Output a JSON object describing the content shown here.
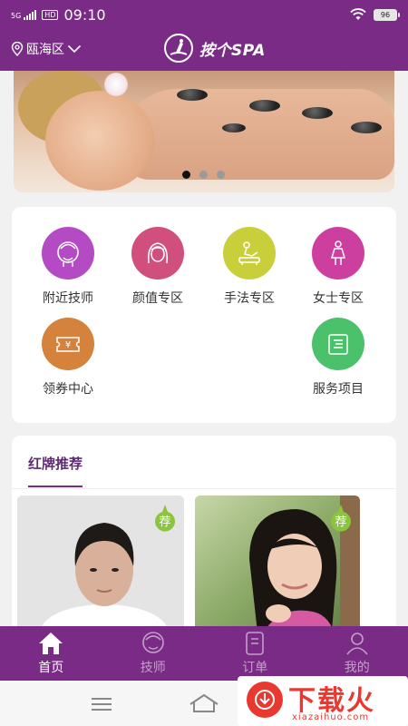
{
  "status": {
    "network": "5G",
    "hd": "HD",
    "time": "09:10",
    "battery": "96"
  },
  "header": {
    "location": "瓯海区",
    "brand": "按个SPA"
  },
  "banner": {
    "slide_count": 3,
    "active_index": 0
  },
  "categories": [
    {
      "label": "附近技师",
      "color": "#b54ac5",
      "icon": "face-profile-icon"
    },
    {
      "label": "颜值专区",
      "color": "#d04f7d",
      "icon": "woman-face-icon"
    },
    {
      "label": "手法专区",
      "color": "#c9cf3a",
      "icon": "massage-hand-icon"
    },
    {
      "label": "女士专区",
      "color": "#cd3f9f",
      "icon": "woman-figure-icon"
    },
    {
      "label": "领券中心",
      "color": "#d5823c",
      "icon": "coupon-icon"
    },
    {
      "label": "服务项目",
      "color": "#4cc16b",
      "icon": "service-folder-icon"
    }
  ],
  "recommend": {
    "title": "红牌推荐",
    "badge": "荐"
  },
  "tabs": [
    {
      "label": "首页",
      "icon": "home-icon",
      "active": true
    },
    {
      "label": "技师",
      "icon": "technician-icon",
      "active": false
    },
    {
      "label": "订单",
      "icon": "order-icon",
      "active": false
    },
    {
      "label": "我的",
      "icon": "profile-icon",
      "active": false
    }
  ],
  "watermark": {
    "text": "下载火",
    "sub": "xiazaihuo.com"
  }
}
